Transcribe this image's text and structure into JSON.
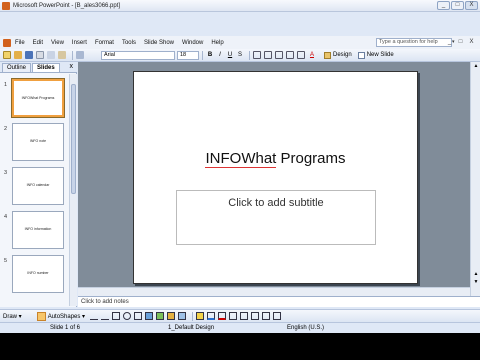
{
  "window": {
    "title": "Microsoft PowerPoint - [B_ales3066.ppt]",
    "minimize": "_",
    "maximize": "□",
    "close": "X"
  },
  "menu": {
    "items": [
      "File",
      "Edit",
      "View",
      "Insert",
      "Format",
      "Tools",
      "Slide Show",
      "Window",
      "Help"
    ],
    "help_placeholder": "Type a question for help"
  },
  "toolbar": {
    "font": "Arial",
    "size": "18",
    "bold": "B",
    "italic": "I",
    "underline": "U",
    "shadow": "S",
    "font_color": "A",
    "design_label": "Design",
    "new_slide_label": "New Slide"
  },
  "pane": {
    "tabs": [
      "Outline",
      "Slides"
    ],
    "active_tab": "Slides",
    "close": "x",
    "thumbnails": [
      {
        "num": "1",
        "text": "INFOWhat Programs"
      },
      {
        "num": "2",
        "text": "INFO note"
      },
      {
        "num": "3",
        "text": "INFO calendar"
      },
      {
        "num": "4",
        "text": "INFO information"
      },
      {
        "num": "5",
        "text": "INFO number"
      }
    ]
  },
  "slide": {
    "title": "INFOWhat Programs",
    "title_prefix": "INFOWhat",
    "title_rest": " Programs",
    "subtitle_placeholder": "Click to add subtitle"
  },
  "notes": {
    "placeholder": "Click to add notes"
  },
  "drawbar": {
    "draw": "Draw ▾",
    "autoshapes": "AutoShapes ▾"
  },
  "status": {
    "slide": "Slide 1 of 6",
    "design": "1_Default Design",
    "language": "English (U.S.)"
  },
  "colors": {
    "chrome": "#dfe8f6",
    "stage": "#808c99",
    "selection": "#f0a040"
  }
}
